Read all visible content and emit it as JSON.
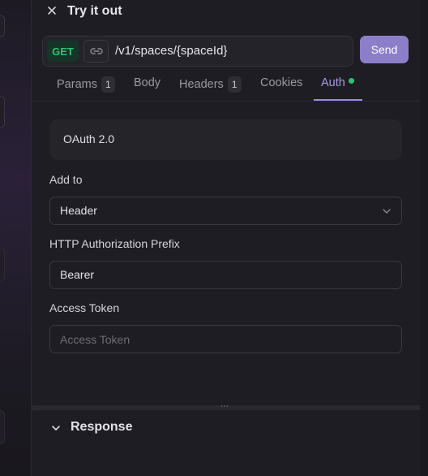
{
  "panel": {
    "title": "Try it out"
  },
  "request": {
    "method": "GET",
    "path": "/v1/spaces/{spaceId}",
    "send_label": "Send"
  },
  "tabs": [
    {
      "label": "Params",
      "badge": "1"
    },
    {
      "label": "Body"
    },
    {
      "label": "Headers",
      "badge": "1"
    },
    {
      "label": "Cookies"
    },
    {
      "label": "Auth",
      "active": true
    }
  ],
  "auth": {
    "scheme": "OAuth 2.0",
    "add_to_label": "Add to",
    "add_to_value": "Header",
    "prefix_label": "HTTP Authorization Prefix",
    "prefix_value": "Bearer",
    "token_label": "Access Token",
    "token_placeholder": "Access Token"
  },
  "response": {
    "title": "Response"
  },
  "colors": {
    "accent": "#9a8de0",
    "send_bg": "#8c7ec9",
    "method_green": "#34c073",
    "status_dot": "#2fbf73"
  },
  "icons": {
    "close": "close-icon",
    "link": "link-icon",
    "select": "chevron-down-icon",
    "response_toggle": "chevron-down-icon"
  }
}
